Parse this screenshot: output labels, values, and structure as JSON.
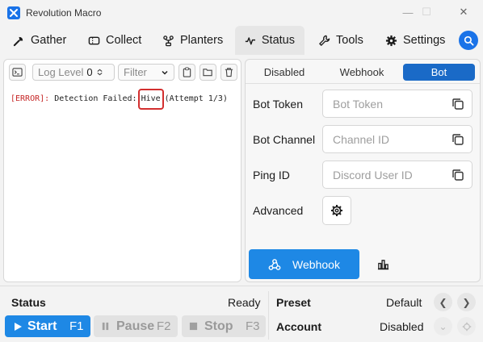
{
  "window": {
    "title": "Revolution Macro",
    "minimize": "—",
    "maximize": "☐",
    "close": "✕"
  },
  "nav": {
    "tabs": [
      {
        "label": "Gather",
        "icon": "gather-icon"
      },
      {
        "label": "Collect",
        "icon": "ticket-icon"
      },
      {
        "label": "Planters",
        "icon": "planter-icon"
      },
      {
        "label": "Status",
        "icon": "pulse-icon",
        "active": true
      },
      {
        "label": "Tools",
        "icon": "wrench-icon"
      },
      {
        "label": "Settings",
        "icon": "gear-icon"
      }
    ]
  },
  "log": {
    "level_label": "Log Level",
    "level_value": "0",
    "filter_label": "Filter",
    "entries": [
      {
        "tag": "[ERROR]:",
        "text": "Detection Failed:",
        "highlight": "Hive",
        "suffix": "(Attempt 1/3)"
      }
    ]
  },
  "right": {
    "tabs": [
      "Disabled",
      "Webhook",
      "Bot"
    ],
    "active_tab": "Bot",
    "fields": [
      {
        "label": "Bot Token",
        "placeholder": "Bot Token"
      },
      {
        "label": "Bot Channel",
        "placeholder": "Channel ID"
      },
      {
        "label": "Ping ID",
        "placeholder": "Discord User ID"
      }
    ],
    "advanced_label": "Advanced",
    "webhook_button": "Webhook"
  },
  "bottom": {
    "status_label": "Status",
    "status_value": "Ready",
    "preset_label": "Preset",
    "preset_value": "Default",
    "account_label": "Account",
    "account_value": "Disabled",
    "start": {
      "label": "Start",
      "key": "F1"
    },
    "pause": {
      "label": "Pause",
      "key": "F2"
    },
    "stop": {
      "label": "Stop",
      "key": "F3"
    }
  },
  "colors": {
    "accent": "#1e88e5",
    "error": "#c62828"
  }
}
